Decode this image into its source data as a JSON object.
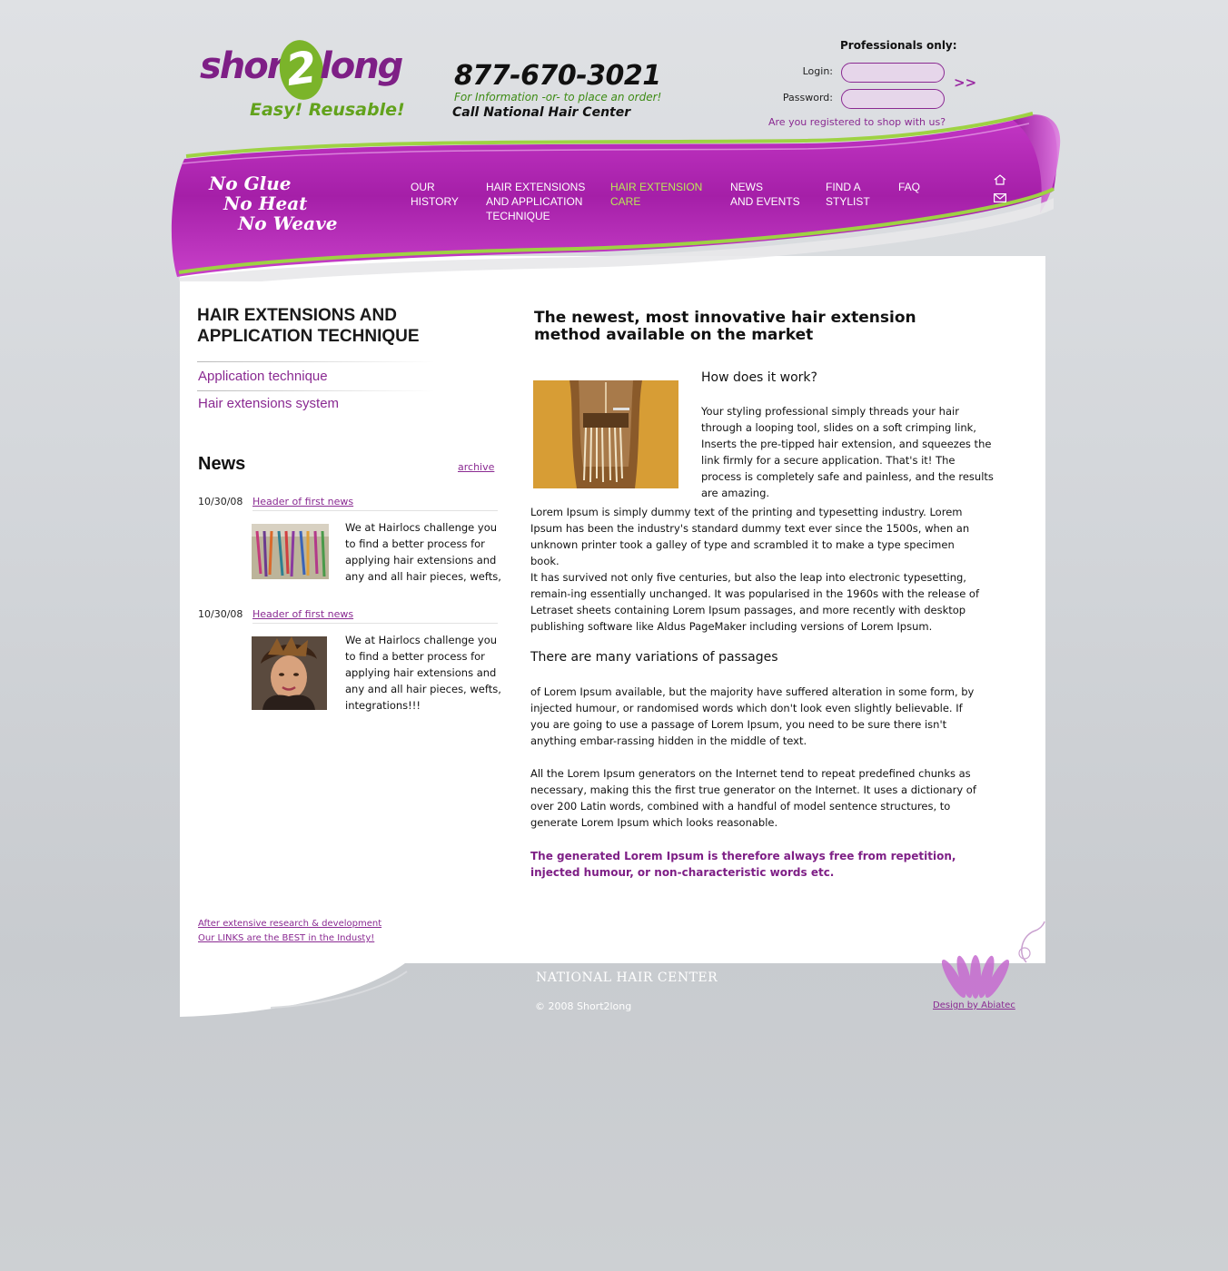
{
  "brand": {
    "logo_short": "short",
    "logo_two": "2",
    "logo_long": "long",
    "tagline": "Easy!  Reusable!",
    "phone": "877-670-3021",
    "phone_info": "For Information -or- to place an order!",
    "phone_call": "Call National Hair Center"
  },
  "login": {
    "title": "Professionals only:",
    "login_label": "Login:",
    "password_label": "Password:",
    "submit": ">>",
    "register": "Are you registered to shop with us?"
  },
  "slogan": {
    "line1": "No Glue",
    "line2": "No Heat",
    "line3": "No Weave"
  },
  "nav": [
    {
      "label": "OUR\nHISTORY",
      "active": false
    },
    {
      "label": "HAIR EXTENSIONS\nAND APPLICATION\nTECHNIQUE",
      "active": false
    },
    {
      "label": "HAIR EXTENSION\nCARE",
      "active": true
    },
    {
      "label": "NEWS\nAND EVENTS",
      "active": false
    },
    {
      "label": "FIND A\nSTYLIST",
      "active": false
    },
    {
      "label": "FAQ",
      "active": false
    }
  ],
  "nav_icons": {
    "home": "home-icon",
    "mail": "mail-icon"
  },
  "sidebar": {
    "title": "HAIR EXTENSIONS AND\nAPPLICATION TECHNIQUE",
    "links": [
      "Application technique",
      "Hair extensions system"
    ]
  },
  "news": {
    "title": "News",
    "archive": "archive",
    "items": [
      {
        "date": "10/30/08",
        "header": "Header of first news",
        "text": "We at Hairlocs challenge you to find a better process for applying hair extensions and any and all hair pieces, wefts,"
      },
      {
        "date": "10/30/08",
        "header": "Header of first news",
        "text": "We at Hairlocs challenge you to find a better process for applying hair extensions and any and all hair pieces, wefts, integrations!!!"
      }
    ]
  },
  "left_footer": {
    "line1": "After extensive research & development",
    "line2": "Our LINKS are the BEST in the Industy!"
  },
  "main": {
    "title": "The newest, most innovative hair extension\nmethod available on the market",
    "how_title": "How does it work?",
    "how_text": "Your styling professional simply threads your hair through a looping tool, slides on a soft crimping link, Inserts the pre-tipped hair extension, and squeezes the link firmly for a secure application. That's it! The process is completely safe and painless, and the results are amazing.",
    "para1": "Lorem Ipsum is simply dummy text of the printing and typesetting industry. Lorem Ipsum has been the industry's standard dummy text ever since the 1500s, when an unknown printer took a galley of type and scrambled it to make a type specimen book.",
    "para2": "It has survived not only five centuries, but also the leap into electronic typesetting, remain-ing essentially unchanged. It was popularised in the 1960s with the release of Letraset sheets containing Lorem Ipsum passages, and more recently with desktop publishing software like Aldus PageMaker including versions of Lorem Ipsum.",
    "sub_title": "There are many variations of passages",
    "para3": " of Lorem Ipsum available, but the majority have suffered alteration in some form, by injected humour, or randomised words which don't look even slightly believable. If you are going to use a passage of Lorem Ipsum, you need to be sure there isn't anything embar-rassing hidden in the middle of text.",
    "para4": "All the Lorem Ipsum generators on the Internet tend to repeat predefined chunks as necessary, making this the first true generator on the Internet. It uses a dictionary of over 200 Latin words, combined with a handful of model sentence structures, to generate Lorem Ipsum which looks reasonable.",
    "highlight": " The generated Lorem Ipsum is therefore always free from repetition, injected humour, or non-characteristic words etc."
  },
  "footer": {
    "nhc": "NATIONAL HAIR CENTER",
    "copyright": "© 2008 Short2long",
    "design": "Design by Abiatec"
  },
  "colors": {
    "brand_purple": "#8a2a92",
    "brand_green": "#62a21c",
    "ribbon_magenta": "#b62bb8",
    "nav_active": "#b9e657"
  }
}
